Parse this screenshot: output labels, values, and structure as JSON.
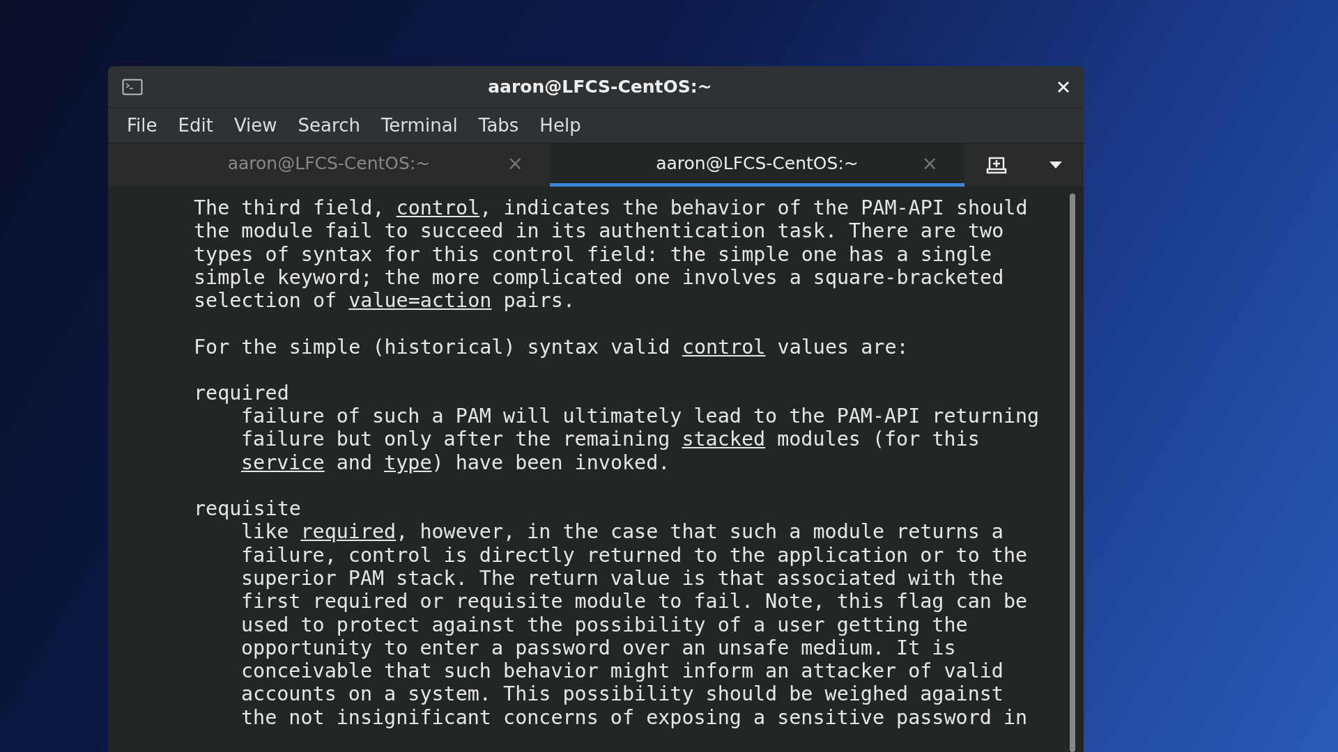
{
  "window": {
    "title": "aaron@LFCS-CentOS:~"
  },
  "menu": [
    "File",
    "Edit",
    "View",
    "Search",
    "Terminal",
    "Tabs",
    "Help"
  ],
  "tabs": [
    {
      "label": "aaron@LFCS-CentOS:~",
      "close": "×",
      "selected": false
    },
    {
      "label": "aaron@LFCS-CentOS:~",
      "close": "×",
      "selected": true
    }
  ],
  "blocks": [
    {
      "kind": "paragraph",
      "lines": [
        [
          {
            "text": "The third field, ",
            "underlined": false
          },
          {
            "text": "control",
            "underlined": true
          },
          {
            "text": ", indicates the behavior of the PAM-API should",
            "underlined": false
          }
        ],
        [
          {
            "text": "the module fail to succeed in its authentication task. There are two",
            "underlined": false
          }
        ],
        [
          {
            "text": "types of syntax for this control field: the simple one has a single",
            "underlined": false
          }
        ],
        [
          {
            "text": "simple keyword; the more complicated one involves a square-bracketed",
            "underlined": false
          }
        ],
        [
          {
            "text": "selection of ",
            "underlined": false
          },
          {
            "text": "value=action",
            "underlined": true
          },
          {
            "text": " pairs.",
            "underlined": false
          }
        ]
      ]
    },
    {
      "kind": "paragraph",
      "lines": [
        [
          {
            "text": "For the simple (historical) syntax valid ",
            "underlined": false
          },
          {
            "text": "control",
            "underlined": true
          },
          {
            "text": " values are:",
            "underlined": false
          }
        ]
      ]
    },
    {
      "kind": "entry",
      "term": "required",
      "lines": [
        [
          {
            "text": "failure of such a PAM will ultimately lead to the PAM-API returning",
            "underlined": false
          }
        ],
        [
          {
            "text": "failure but only after the remaining ",
            "underlined": false
          },
          {
            "text": "stacked",
            "underlined": true
          },
          {
            "text": " modules (for this",
            "underlined": false
          }
        ],
        [
          {
            "text": "service",
            "underlined": true
          },
          {
            "text": " and ",
            "underlined": false
          },
          {
            "text": "type",
            "underlined": true
          },
          {
            "text": ") have been invoked.",
            "underlined": false
          }
        ]
      ]
    },
    {
      "kind": "entry",
      "term": "requisite",
      "lines": [
        [
          {
            "text": "like ",
            "underlined": false
          },
          {
            "text": "required",
            "underlined": true
          },
          {
            "text": ", however, in the case that such a module returns a",
            "underlined": false
          }
        ],
        [
          {
            "text": "failure, control is directly returned to the application or to the",
            "underlined": false
          }
        ],
        [
          {
            "text": "superior PAM stack. The return value is that associated with the",
            "underlined": false
          }
        ],
        [
          {
            "text": "first required or requisite module to fail. Note, this flag can be",
            "underlined": false
          }
        ],
        [
          {
            "text": "used to protect against the possibility of a user getting the",
            "underlined": false
          }
        ],
        [
          {
            "text": "opportunity to enter a password over an unsafe medium. It is",
            "underlined": false
          }
        ],
        [
          {
            "text": "conceivable that such behavior might inform an attacker of valid",
            "underlined": false
          }
        ],
        [
          {
            "text": "accounts on a system. This possibility should be weighed against",
            "underlined": false
          }
        ],
        [
          {
            "text": "the not insignificant concerns of exposing a sensitive password in",
            "underlined": false
          }
        ]
      ]
    }
  ]
}
